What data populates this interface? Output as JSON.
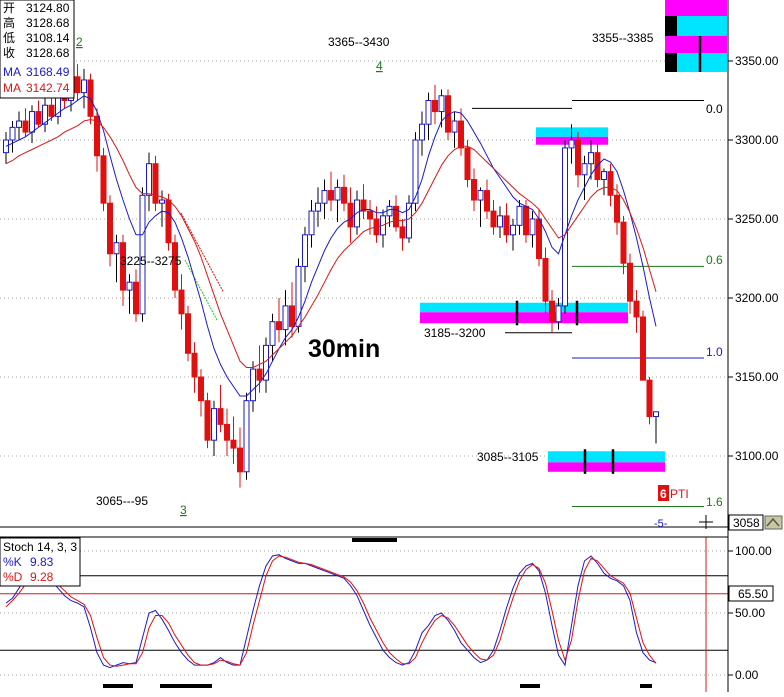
{
  "ohlc_box": {
    "open_label": "开",
    "open_value": "3124.80",
    "high_label": "高",
    "high_value": "3128.68",
    "low_label": "低",
    "low_value": "3108.14",
    "close_label": "收",
    "close_value": "3128.68",
    "ma1_label": "MA",
    "ma1_value": "3168.49",
    "ma2_label": "MA",
    "ma2_value": "3142.74"
  },
  "annotations": {
    "timeframe": "30min",
    "zone_top": "3355--3385",
    "zone_upper": "3365--3430",
    "zone_mid_left": "3225--3275",
    "zone_mid": "3185--3200",
    "zone_low": "3085--3105",
    "zone_bottom": "3065---95",
    "wave_2": "2",
    "wave_3": "3",
    "wave_4": "4",
    "wave_5": "-5-",
    "fib_0": "0.0",
    "fib_06": "0.6",
    "fib_10": "1.0",
    "fib_16": "1.6",
    "pti_number": "6",
    "pti_text": "PTI",
    "last_price": "3058"
  },
  "colors": {
    "up": "#1a1acc",
    "down": "#e01010",
    "ma_fast": "#1a1acc",
    "ma_slow": "#d81818",
    "cyan": "#00e5ff",
    "magenta": "#ff00ff",
    "fib_green": "#1a7a1a",
    "wave_green": "#1a7a1a"
  },
  "chart_data": [
    {
      "type": "candlestick",
      "title": "",
      "ylim": [
        3050,
        3375
      ],
      "y_ticks": [
        3100,
        3150,
        3200,
        3250,
        3300,
        3350
      ],
      "y_tick_labels": [
        "3100.00",
        "3150.00",
        "3200.00",
        "3250.00",
        "3300.00",
        "3350.00"
      ],
      "grid": true,
      "candles": [
        [
          3292,
          3305,
          3285,
          3300
        ],
        [
          3300,
          3312,
          3292,
          3308
        ],
        [
          3308,
          3318,
          3300,
          3312
        ],
        [
          3312,
          3320,
          3302,
          3305
        ],
        [
          3305,
          3322,
          3298,
          3318
        ],
        [
          3318,
          3325,
          3308,
          3310
        ],
        [
          3310,
          3328,
          3305,
          3322
        ],
        [
          3322,
          3330,
          3312,
          3315
        ],
        [
          3315,
          3335,
          3310,
          3330
        ],
        [
          3330,
          3340,
          3320,
          3325
        ],
        [
          3325,
          3345,
          3318,
          3340
        ],
        [
          3340,
          3348,
          3325,
          3330
        ],
        [
          3330,
          3345,
          3320,
          3338
        ],
        [
          3338,
          3342,
          3310,
          3315
        ],
        [
          3315,
          3320,
          3280,
          3290
        ],
        [
          3290,
          3295,
          3255,
          3260
        ],
        [
          3260,
          3265,
          3220,
          3228
        ],
        [
          3228,
          3240,
          3210,
          3235
        ],
        [
          3235,
          3240,
          3195,
          3205
        ],
        [
          3205,
          3215,
          3190,
          3210
        ],
        [
          3210,
          3218,
          3185,
          3190
        ],
        [
          3190,
          3270,
          3185,
          3265
        ],
        [
          3265,
          3292,
          3255,
          3285
        ],
        [
          3285,
          3290,
          3255,
          3260
        ],
        [
          3260,
          3268,
          3245,
          3262
        ],
        [
          3262,
          3266,
          3230,
          3235
        ],
        [
          3235,
          3240,
          3200,
          3205
        ],
        [
          3205,
          3215,
          3180,
          3190
        ],
        [
          3190,
          3195,
          3160,
          3165
        ],
        [
          3165,
          3172,
          3140,
          3150
        ],
        [
          3150,
          3155,
          3125,
          3135
        ],
        [
          3135,
          3140,
          3105,
          3110
        ],
        [
          3110,
          3135,
          3100,
          3130
        ],
        [
          3130,
          3145,
          3115,
          3120
        ],
        [
          3120,
          3130,
          3100,
          3110
        ],
        [
          3110,
          3125,
          3095,
          3105
        ],
        [
          3105,
          3118,
          3080,
          3090
        ],
        [
          3090,
          3140,
          3085,
          3135
        ],
        [
          3135,
          3160,
          3128,
          3155
        ],
        [
          3155,
          3170,
          3140,
          3148
        ],
        [
          3148,
          3175,
          3140,
          3170
        ],
        [
          3170,
          3190,
          3160,
          3185
        ],
        [
          3185,
          3200,
          3172,
          3180
        ],
        [
          3180,
          3205,
          3170,
          3195
        ],
        [
          3195,
          3210,
          3175,
          3182
        ],
        [
          3182,
          3225,
          3178,
          3220
        ],
        [
          3220,
          3245,
          3210,
          3240
        ],
        [
          3240,
          3262,
          3232,
          3255
        ],
        [
          3255,
          3270,
          3245,
          3260
        ],
        [
          3260,
          3275,
          3250,
          3268
        ],
        [
          3268,
          3280,
          3255,
          3262
        ],
        [
          3262,
          3275,
          3248,
          3270
        ],
        [
          3270,
          3278,
          3255,
          3260
        ],
        [
          3260,
          3270,
          3235,
          3245
        ],
        [
          3245,
          3268,
          3240,
          3262
        ],
        [
          3262,
          3272,
          3250,
          3255
        ],
        [
          3255,
          3262,
          3240,
          3250
        ],
        [
          3250,
          3258,
          3235,
          3240
        ],
        [
          3240,
          3256,
          3232,
          3252
        ],
        [
          3252,
          3262,
          3245,
          3258
        ],
        [
          3258,
          3265,
          3242,
          3245
        ],
        [
          3245,
          3250,
          3230,
          3238
        ],
        [
          3238,
          3265,
          3235,
          3260
        ],
        [
          3260,
          3305,
          3255,
          3300
        ],
        [
          3300,
          3318,
          3290,
          3310
        ],
        [
          3310,
          3330,
          3300,
          3325
        ],
        [
          3325,
          3335,
          3310,
          3318
        ],
        [
          3318,
          3332,
          3308,
          3328
        ],
        [
          3328,
          3332,
          3300,
          3305
        ],
        [
          3305,
          3318,
          3295,
          3312
        ],
        [
          3312,
          3320,
          3290,
          3295
        ],
        [
          3295,
          3300,
          3270,
          3275
        ],
        [
          3275,
          3282,
          3255,
          3262
        ],
        [
          3262,
          3270,
          3245,
          3268
        ],
        [
          3268,
          3275,
          3250,
          3255
        ],
        [
          3255,
          3262,
          3240,
          3245
        ],
        [
          3245,
          3258,
          3238,
          3252
        ],
        [
          3252,
          3260,
          3235,
          3240
        ],
        [
          3240,
          3250,
          3230,
          3246
        ],
        [
          3246,
          3262,
          3240,
          3258
        ],
        [
          3258,
          3262,
          3235,
          3240
        ],
        [
          3240,
          3255,
          3232,
          3250
        ],
        [
          3250,
          3256,
          3220,
          3225
        ],
        [
          3225,
          3232,
          3190,
          3198
        ],
        [
          3198,
          3205,
          3178,
          3185
        ],
        [
          3185,
          3200,
          3180,
          3195
        ],
        [
          3195,
          3300,
          3190,
          3295
        ],
        [
          3295,
          3310,
          3285,
          3300
        ],
        [
          3300,
          3305,
          3270,
          3278
        ],
        [
          3278,
          3290,
          3262,
          3285
        ],
        [
          3285,
          3300,
          3275,
          3292
        ],
        [
          3292,
          3298,
          3270,
          3275
        ],
        [
          3275,
          3282,
          3265,
          3280
        ],
        [
          3280,
          3285,
          3258,
          3265
        ],
        [
          3265,
          3272,
          3240,
          3248
        ],
        [
          3248,
          3252,
          3215,
          3222
        ],
        [
          3222,
          3228,
          3190,
          3198
        ],
        [
          3198,
          3205,
          3178,
          3188
        ],
        [
          3188,
          3192,
          3150,
          3148
        ],
        [
          3148,
          3150,
          3120,
          3125
        ],
        [
          3125,
          3128,
          3108,
          3128
        ]
      ],
      "ma_fast": [
        3296,
        3298,
        3300,
        3302,
        3305,
        3308,
        3311,
        3314,
        3317,
        3320,
        3322,
        3325,
        3328,
        3326,
        3318,
        3306,
        3290,
        3275,
        3262,
        3250,
        3240,
        3240,
        3248,
        3252,
        3255,
        3254,
        3248,
        3238,
        3226,
        3212,
        3198,
        3182,
        3168,
        3158,
        3150,
        3144,
        3138,
        3138,
        3142,
        3146,
        3152,
        3160,
        3168,
        3175,
        3180,
        3188,
        3198,
        3210,
        3220,
        3230,
        3238,
        3244,
        3248,
        3250,
        3254,
        3256,
        3256,
        3254,
        3254,
        3256,
        3256,
        3254,
        3256,
        3264,
        3275,
        3290,
        3302,
        3312,
        3316,
        3318,
        3317,
        3312,
        3305,
        3298,
        3290,
        3282,
        3276,
        3270,
        3264,
        3260,
        3258,
        3256,
        3250,
        3242,
        3232,
        3228,
        3240,
        3252,
        3262,
        3270,
        3278,
        3284,
        3288,
        3286,
        3280,
        3268,
        3254,
        3238,
        3220,
        3200,
        3182
      ],
      "ma_slow": [
        3285,
        3287,
        3290,
        3292,
        3294,
        3296,
        3298,
        3300,
        3302,
        3305,
        3307,
        3309,
        3312,
        3313,
        3312,
        3308,
        3302,
        3295,
        3287,
        3278,
        3270,
        3266,
        3266,
        3265,
        3264,
        3262,
        3258,
        3252,
        3244,
        3236,
        3226,
        3214,
        3202,
        3190,
        3180,
        3170,
        3160,
        3156,
        3156,
        3158,
        3160,
        3164,
        3168,
        3172,
        3176,
        3182,
        3188,
        3195,
        3202,
        3210,
        3218,
        3225,
        3230,
        3234,
        3238,
        3242,
        3244,
        3245,
        3246,
        3248,
        3249,
        3249,
        3250,
        3254,
        3260,
        3268,
        3276,
        3284,
        3290,
        3294,
        3296,
        3296,
        3294,
        3290,
        3286,
        3282,
        3278,
        3274,
        3270,
        3266,
        3263,
        3260,
        3256,
        3250,
        3244,
        3238,
        3240,
        3246,
        3252,
        3258,
        3264,
        3268,
        3270,
        3270,
        3268,
        3262,
        3254,
        3244,
        3232,
        3218,
        3204
      ]
    },
    {
      "type": "line",
      "title": "Stoch 14, 3, 3",
      "ylim": [
        -10,
        112
      ],
      "y_ticks": [
        0,
        50,
        100
      ],
      "y_tick_labels": [
        "0.00",
        "50.00",
        "100.00"
      ],
      "level_line": 65.5,
      "level_label": "65.50",
      "series": [
        {
          "name": "%K",
          "label_value": "9.83",
          "values": [
            58,
            62,
            70,
            78,
            80,
            82,
            80,
            76,
            70,
            64,
            60,
            58,
            55,
            38,
            18,
            8,
            6,
            8,
            10,
            9,
            10,
            30,
            50,
            52,
            45,
            36,
            26,
            18,
            12,
            8,
            8,
            8,
            10,
            14,
            10,
            8,
            8,
            30,
            52,
            72,
            88,
            96,
            97,
            94,
            92,
            90,
            90,
            88,
            86,
            84,
            82,
            80,
            78,
            72,
            64,
            52,
            40,
            30,
            20,
            14,
            10,
            8,
            10,
            20,
            34,
            40,
            48,
            50,
            44,
            36,
            26,
            20,
            14,
            10,
            12,
            20,
            36,
            54,
            70,
            82,
            88,
            90,
            84,
            66,
            40,
            16,
            8,
            40,
            72,
            92,
            96,
            90,
            82,
            78,
            76,
            72,
            60,
            34,
            18,
            12,
            9.83
          ]
        },
        {
          "name": "%D",
          "label_value": "9.28",
          "values": [
            55,
            60,
            66,
            73,
            78,
            80,
            80,
            78,
            73,
            68,
            63,
            60,
            57,
            48,
            30,
            14,
            8,
            7,
            8,
            9,
            9,
            18,
            38,
            48,
            48,
            42,
            32,
            24,
            16,
            10,
            8,
            8,
            9,
            12,
            11,
            9,
            8,
            18,
            40,
            60,
            80,
            92,
            96,
            95,
            93,
            91,
            90,
            89,
            87,
            85,
            83,
            81,
            79,
            75,
            68,
            58,
            46,
            36,
            26,
            18,
            13,
            9,
            9,
            14,
            26,
            36,
            44,
            48,
            46,
            40,
            32,
            24,
            18,
            13,
            12,
            16,
            28,
            46,
            62,
            76,
            85,
            89,
            86,
            74,
            52,
            28,
            12,
            28,
            60,
            84,
            94,
            92,
            86,
            80,
            77,
            74,
            66,
            46,
            26,
            16,
            9.28
          ]
        }
      ]
    }
  ]
}
